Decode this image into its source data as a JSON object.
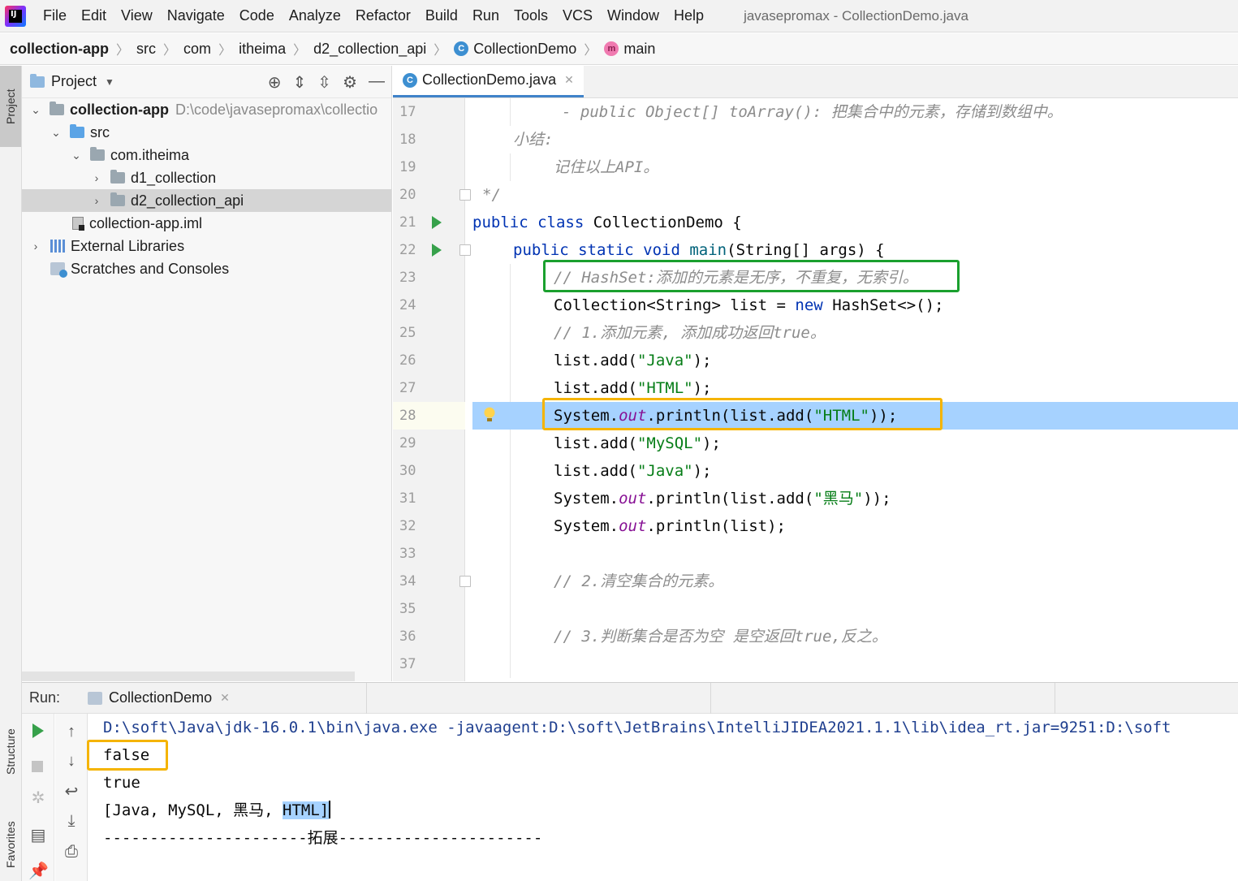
{
  "menubar": {
    "items": [
      "File",
      "Edit",
      "View",
      "Navigate",
      "Code",
      "Analyze",
      "Refactor",
      "Build",
      "Run",
      "Tools",
      "VCS",
      "Window",
      "Help"
    ],
    "window_title": "javasepromax - CollectionDemo.java"
  },
  "navbar": {
    "crumbs": [
      "collection-app",
      "src",
      "com",
      "itheima",
      "d2_collection_api",
      "CollectionDemo",
      "main"
    ]
  },
  "stripe": {
    "project": "Project",
    "structure": "Structure",
    "favorites": "Favorites"
  },
  "project_panel": {
    "title": "Project",
    "tree": [
      {
        "label": "collection-app",
        "path": "D:\\code\\javasepromax\\collectio",
        "arrow": "open"
      },
      {
        "label": "src",
        "arrow": "open"
      },
      {
        "label": "com.itheima",
        "arrow": "open"
      },
      {
        "label": "d1_collection",
        "arrow": "closed"
      },
      {
        "label": "d2_collection_api",
        "arrow": "closed"
      },
      {
        "label": "collection-app.iml",
        "arrow": ""
      },
      {
        "label": "External Libraries",
        "arrow": "closed"
      },
      {
        "label": "Scratches and Consoles",
        "arrow": ""
      }
    ]
  },
  "editor": {
    "tab_label": "CollectionDemo.java",
    "lines": [
      {
        "num": "17",
        "text": "- public Object[] toArray(): 把集合中的元素，存储到数组中。"
      },
      {
        "num": "18",
        "text": "小结:"
      },
      {
        "num": "19",
        "text": "记住以上API。"
      },
      {
        "num": "20",
        "text": "*/"
      },
      {
        "num": "21",
        "kw1": "public class",
        "rest": " CollectionDemo {"
      },
      {
        "num": "22",
        "kw1": "public static void",
        "meth": "main",
        "rest": "(String[] args) {"
      },
      {
        "num": "23",
        "text": "// HashSet:添加的元素是无序，不重复，无索引。"
      },
      {
        "num": "24",
        "pre": "Collection<String> list = ",
        "kw1": "new",
        "rest": " HashSet<>();"
      },
      {
        "num": "25",
        "text": "// 1.添加元素, 添加成功返回true。"
      },
      {
        "num": "26",
        "pre": "list.add(",
        "str": "\"Java\"",
        "rest": ");"
      },
      {
        "num": "27",
        "pre": "list.add(",
        "str": "\"HTML\"",
        "rest": ");"
      },
      {
        "num": "28",
        "pre": "System.",
        "field": "out",
        "mid": ".println(list.add(",
        "str": "\"HTML\"",
        "rest": "));"
      },
      {
        "num": "29",
        "pre": "list.add(",
        "str": "\"MySQL\"",
        "rest": ");"
      },
      {
        "num": "30",
        "pre": "list.add(",
        "str": "\"Java\"",
        "rest": ");"
      },
      {
        "num": "31",
        "pre": "System.",
        "field": "out",
        "mid": ".println(list.add(",
        "str": "\"黑马\"",
        "rest": "));"
      },
      {
        "num": "32",
        "pre": "System.",
        "field": "out",
        "mid": ".println(list);"
      },
      {
        "num": "33",
        "text": ""
      },
      {
        "num": "34",
        "text": "// 2.清空集合的元素。"
      },
      {
        "num": "35",
        "text": ""
      },
      {
        "num": "36",
        "text": "// 3.判断集合是否为空 是空返回true,反之。"
      },
      {
        "num": "37",
        "text": ""
      }
    ]
  },
  "run_panel": {
    "label": "Run:",
    "tab_label": "CollectionDemo",
    "console": [
      "D:\\soft\\Java\\jdk-16.0.1\\bin\\java.exe -javaagent:D:\\soft\\JetBrains\\IntelliJIDEA2021.1.1\\lib\\idea_rt.jar=9251:D:\\soft",
      "false",
      "true",
      "[Java, MySQL, 黑马, ",
      "HTML]",
      "----------------------拓展----------------------"
    ]
  },
  "colors": {
    "green_box": "#1aa02e",
    "orange_box": "#f5b400",
    "selection": "#a6d2ff"
  }
}
